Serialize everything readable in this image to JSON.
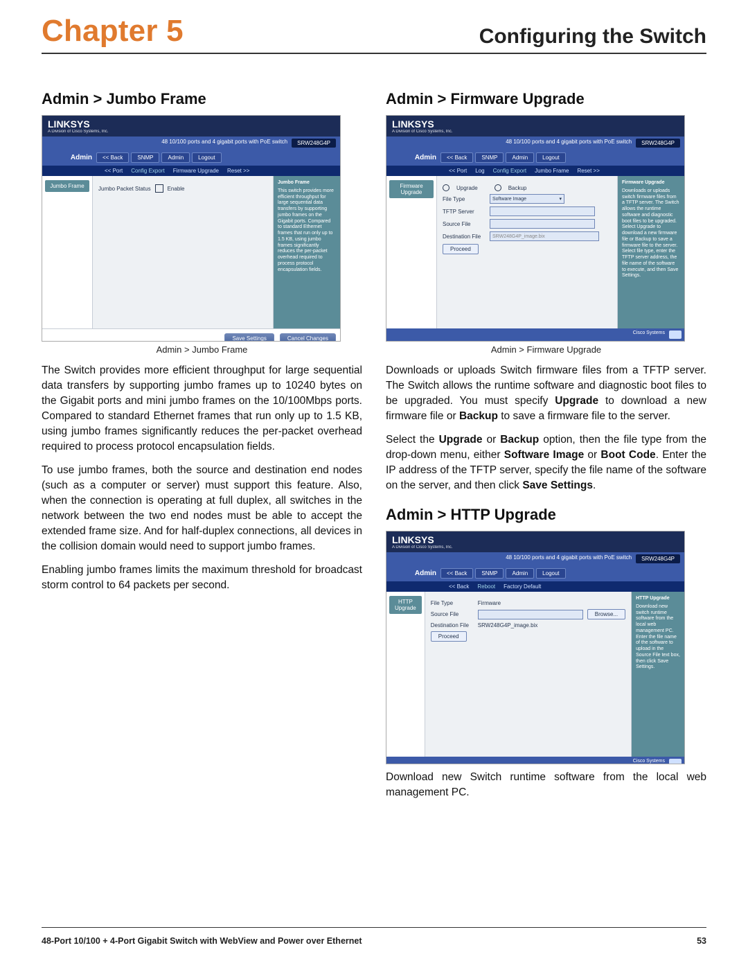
{
  "header": {
    "chapter": "Chapter 5",
    "title": "Configuring the Switch"
  },
  "left": {
    "heading": "Admin > Jumbo Frame",
    "caption": "Admin > Jumbo Frame",
    "p1": "The Switch provides more efficient throughput for large sequential data transfers by supporting jumbo frames up to 10240 bytes on the Gigabit ports and mini jumbo frames on the 10/100Mbps ports. Compared to standard Ethernet frames that run only up to 1.5 KB, using jumbo frames significantly reduces the per-packet overhead required to process protocol encapsulation fields.",
    "p2": "To use jumbo frames, both the source and destination end nodes (such as a computer or server) must support this feature. Also, when the connection is operating at full duplex, all switches in the network between the two end nodes must be able to accept the extended frame size. And for half-duplex connections, all devices in the collision domain would need to support jumbo frames.",
    "p3": "Enabling jumbo frames limits the maximum threshold for broadcast storm control to 64 packets per second."
  },
  "right": {
    "heading1": "Admin > Firmware Upgrade",
    "caption1": "Admin > Firmware Upgrade",
    "p1a": "Downloads or uploads Switch firmware files from a TFTP server. The Switch allows the runtime software and diagnostic boot files to be upgraded. You must specify ",
    "p1b_upgrade": "Upgrade",
    "p1c": " to download a new firmware file or ",
    "p1d_backup": "Backup",
    "p1e": " to save a firmware file to the server.",
    "p2a": "Select the ",
    "p2b_upgrade": "Upgrade",
    "p2c": " or ",
    "p2d_backup": "Backup",
    "p2e": " option, then the file type from the drop-down menu, either ",
    "p2f_sw": "Software Image",
    "p2g": " or ",
    "p2h_bc": "Boot Code",
    "p2i": ". Enter the IP address of the TFTP server, specify the file name of the software on the server, and then click ",
    "p2j_save": "Save Settings",
    "p2k": ".",
    "heading2": "Admin > HTTP Upgrade",
    "p3": "Download new Switch runtime software from the local web management PC."
  },
  "shot_common": {
    "brand": "LINKSYS",
    "brand_sub": "A Division of Cisco Systems, Inc.",
    "model_line": "48 10/100 ports and 4 gigabit ports with PoE switch",
    "model": "SRW248G4P",
    "admin": "Admin",
    "tabs": [
      "<< Back",
      "SNMP",
      "Admin",
      "Logout"
    ]
  },
  "shot1": {
    "subtabs": [
      "<< Port",
      "",
      "Config Export",
      "Firmware Upgrade",
      "",
      "Reset >>"
    ],
    "side": "Jumbo Frame",
    "field": "Jumbo Packet Status",
    "checkbox": "Enable",
    "help_h": "Jumbo Frame",
    "help": "This switch provides more efficient throughput for large sequential data transfers by supporting jumbo frames on the Gigabit ports. Compared to standard Ethernet frames that run only up to 1.5 KB, using jumbo frames significantly reduces the per-packet overhead required to process protocol encapsulation fields.",
    "save": "Save Settings",
    "cancel": "Cancel Changes"
  },
  "shot2": {
    "subtabs": [
      "<< Port",
      "Log",
      "Config Export",
      "Jumbo Frame",
      "",
      "Reset >>"
    ],
    "side": "Firmware Upgrade",
    "r_up": "Upgrade",
    "r_bk": "Backup",
    "f_type": "File Type",
    "f_type_v": "Software Image",
    "f_tftp": "TFTP Server",
    "f_src": "Source File",
    "f_dst": "Destination File",
    "f_dst_v": "SRW248G4P_image.bix",
    "proceed": "Proceed",
    "help_h": "Firmware Upgrade",
    "help": "Downloads or uploads switch firmware files from a TFTP server. The Switch allows the runtime software and diagnostic boot files to be upgraded. Select Upgrade to download a new firmware file or Backup to save a firmware file to the server. Select file type, enter the TFTP server address, the file name of the software to execute, and then Save Settings."
  },
  "shot3": {
    "subtabs": [
      "<< Back",
      "",
      "Reboot",
      "Factory Default"
    ],
    "side": "HTTP Upgrade",
    "f_type": "File Type",
    "f_type_v": "Firmware",
    "f_src": "Source File",
    "browse": "Browse...",
    "f_dst": "Destination File",
    "f_dst_v": "SRW248G4P_image.bix",
    "proceed": "Proceed",
    "help_h": "HTTP Upgrade",
    "help": "Download new switch runtime software from the local web management PC. Enter the file name of the software to upload in the Source File text box, then click Save Settings."
  },
  "footer": {
    "left": "48-Port 10/100 + 4-Port Gigabit Switch with WebView and Power over Ethernet",
    "right": "53"
  }
}
